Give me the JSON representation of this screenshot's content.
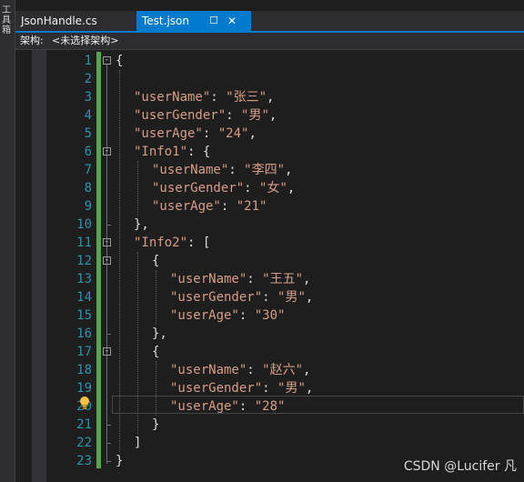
{
  "sidebar": {
    "toolbox_label": "工具箱"
  },
  "tabs": [
    {
      "label": "JsonHandle.cs",
      "active": false
    },
    {
      "label": "Test.json",
      "active": true,
      "pin_icon": "pin-icon",
      "close_icon": "close-icon"
    }
  ],
  "schema_bar": {
    "label": "架构:",
    "value": "<未选择架构>"
  },
  "editor": {
    "line_numbers": [
      "1",
      "2",
      "3",
      "4",
      "5",
      "6",
      "7",
      "8",
      "9",
      "10",
      "11",
      "12",
      "13",
      "14",
      "15",
      "16",
      "17",
      "18",
      "19",
      "20",
      "21",
      "22",
      "23"
    ],
    "lines": [
      {
        "open": "{"
      },
      {},
      {
        "key": "\"userName\"",
        "sep": ": ",
        "value": "\"张三\"",
        "end": ","
      },
      {
        "key": "\"userGender\"",
        "sep": ": ",
        "value": "\"男\"",
        "end": ","
      },
      {
        "key": "\"userAge\"",
        "sep": ": ",
        "value": "\"24\"",
        "end": ","
      },
      {
        "key": "\"Info1\"",
        "sep": ": ",
        "open": "{"
      },
      {
        "key": "\"userName\"",
        "sep": ": ",
        "value": "\"李四\"",
        "end": ","
      },
      {
        "key": "\"userGender\"",
        "sep": ": ",
        "value": "\"女\"",
        "end": ","
      },
      {
        "key": "\"userAge\"",
        "sep": ": ",
        "value": "\"21\""
      },
      {
        "close": "},"
      },
      {
        "key": "\"Info2\"",
        "sep": ": ",
        "open": "["
      },
      {
        "open": "{"
      },
      {
        "key": "\"userName\"",
        "sep": ": ",
        "value": "\"王五\"",
        "end": ","
      },
      {
        "key": "\"userGender\"",
        "sep": ": ",
        "value": "\"男\"",
        "end": ","
      },
      {
        "key": "\"userAge\"",
        "sep": ": ",
        "value": "\"30\""
      },
      {
        "close": "},"
      },
      {
        "open": "{"
      },
      {
        "key": "\"userName\"",
        "sep": ": ",
        "value": "\"赵六\"",
        "end": ","
      },
      {
        "key": "\"userGender\"",
        "sep": ": ",
        "value": "\"男\"",
        "end": ","
      },
      {
        "key": "\"userAge\"",
        "sep": ": ",
        "value": "\"28\""
      },
      {
        "close": "}"
      },
      {
        "close": "]"
      },
      {
        "close": "}"
      }
    ],
    "current_line": "20",
    "lightbulb_icon": "lightbulb-icon"
  },
  "watermark": "CSDN @Lucifer 凡",
  "colors": {
    "background": "#1e1e1e",
    "accent": "#007acc",
    "line_number": "#2b91af",
    "string": "#d69d85",
    "change_bar": "#57a64a"
  }
}
